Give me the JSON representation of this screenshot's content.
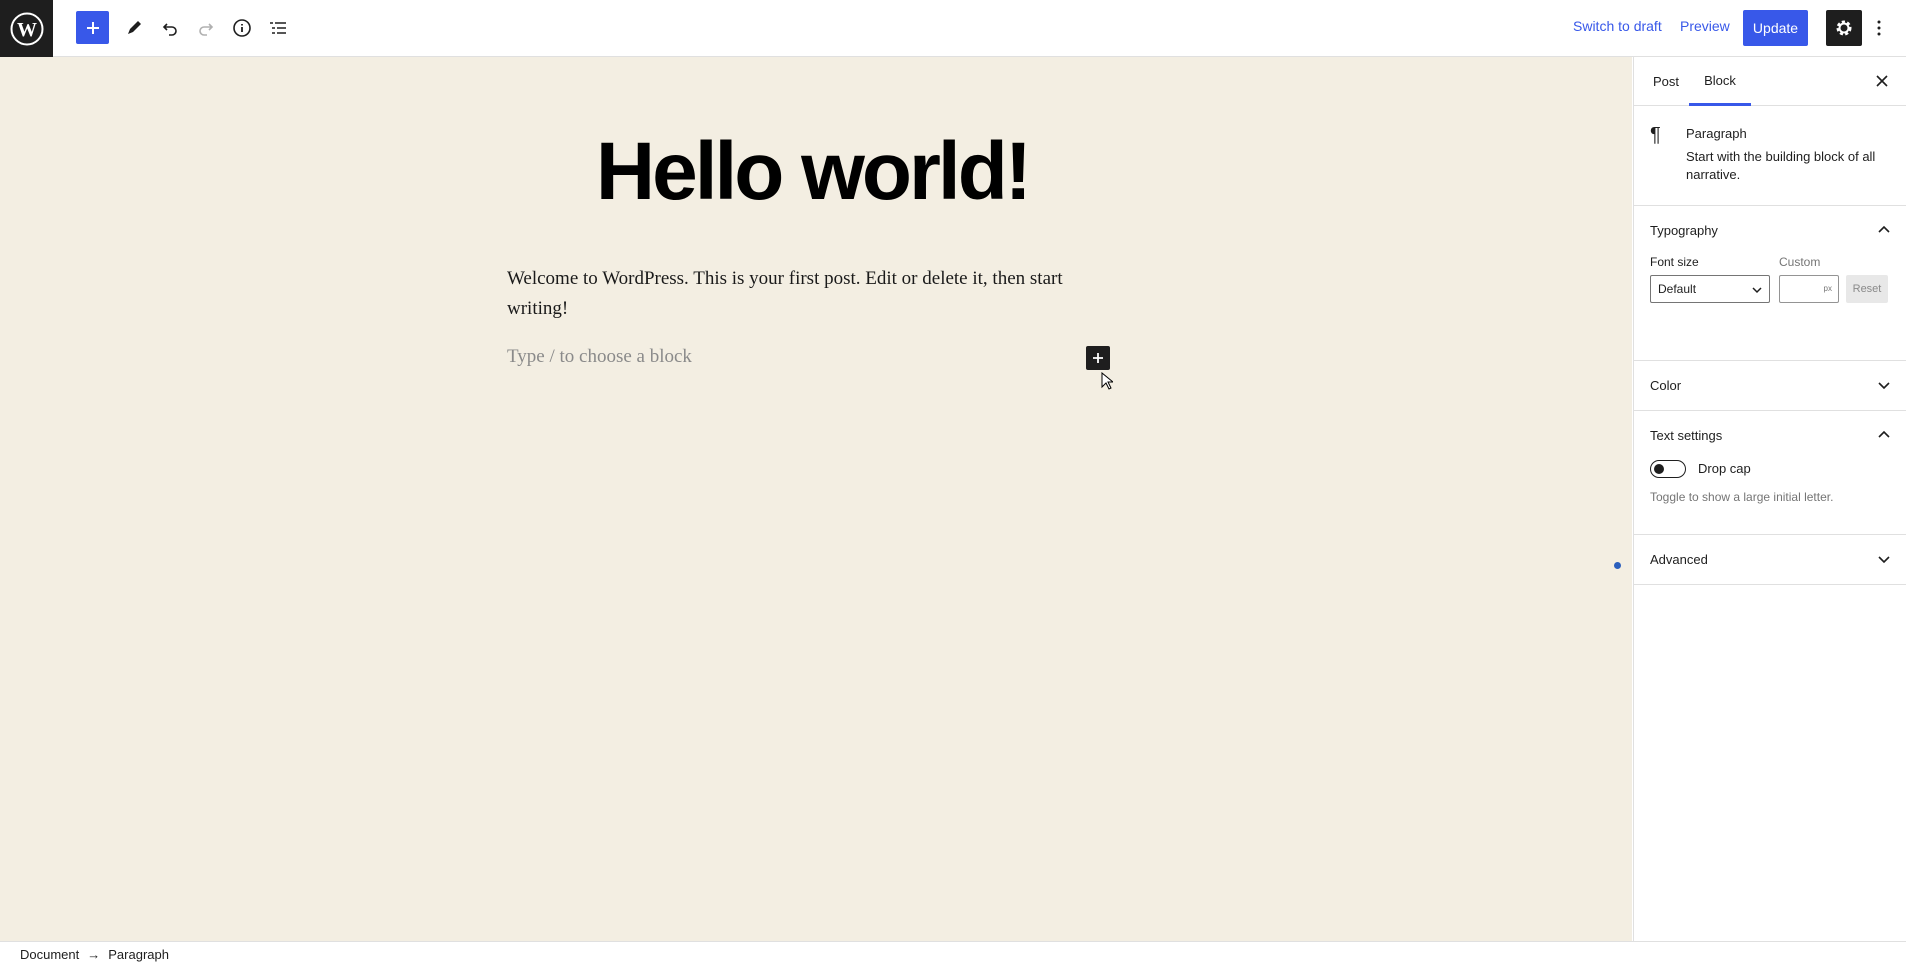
{
  "toolbar": {
    "switch_to_draft": "Switch to draft",
    "preview": "Preview",
    "update": "Update",
    "icons": [
      "wordpress-logo",
      "plus-icon",
      "pencil-icon",
      "undo-icon",
      "redo-icon",
      "info-icon",
      "list-view-icon",
      "gear-icon",
      "more-vertical-icon"
    ]
  },
  "editor": {
    "title": "Hello world!",
    "paragraph": "Welcome to WordPress. This is your first post. Edit or delete it, then start writing!",
    "placeholder": "Type / to choose a block"
  },
  "sidebar": {
    "tabs": [
      "Post",
      "Block"
    ],
    "active_tab": "Block",
    "block": {
      "name": "Paragraph",
      "description": "Start with the building block of all narrative."
    },
    "typography": {
      "title": "Typography",
      "font_size_label": "Font size",
      "custom_label": "Custom",
      "font_size_value": "Default",
      "unit": "px",
      "reset": "Reset"
    },
    "color": {
      "title": "Color"
    },
    "text_settings": {
      "title": "Text settings",
      "drop_cap_label": "Drop cap",
      "drop_cap_help": "Toggle to show a large initial letter."
    },
    "advanced": {
      "title": "Advanced"
    }
  },
  "breadcrumb": {
    "items": [
      "Document",
      "Paragraph"
    ],
    "separator": "→"
  },
  "colors": {
    "accent": "#3858e9",
    "canvas_bg": "#f3eee2",
    "dark": "#1e1e1e"
  }
}
